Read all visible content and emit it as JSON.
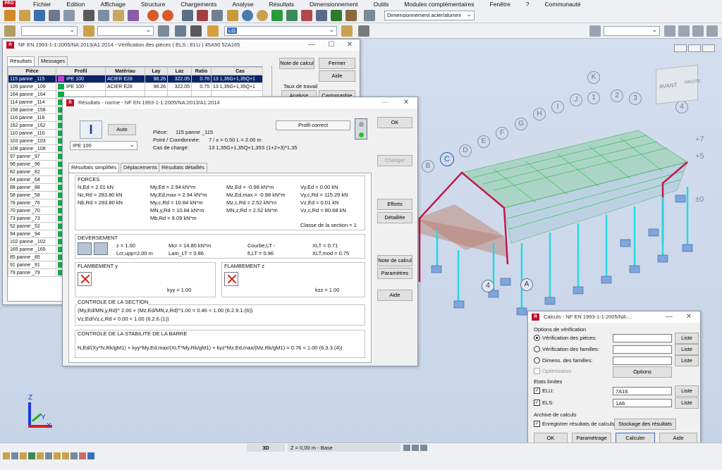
{
  "menu": [
    "Fichier",
    "Edition",
    "Affichage",
    "Structure",
    "Chargements",
    "Analyse",
    "Résultats",
    "Dimensionnement",
    "Outils",
    "Modules complémentaires",
    "Fenêtre",
    "?",
    "Communauté"
  ],
  "toolbar": {
    "dimension_combo": "Dimensionnement acier/alumini",
    "layer_value": "LG"
  },
  "results_window": {
    "title": "NF EN 1993-1-1:2005/NA:2013/A1:2014 - Vérification des pièces ( ELS ; ELU ) 45A50 52A165",
    "tabs": [
      "Résultats",
      "Messages"
    ],
    "columns": [
      "Pièce",
      "Profil",
      "Matériau",
      "Lay",
      "Laz",
      "Ratio",
      "Cas"
    ],
    "rows": [
      {
        "piece": "115  panne _115",
        "profil": "IPE 100",
        "mat": "ACIER E28",
        "lay": "98.26",
        "laz": "322.05",
        "ratio": "0.76",
        "cas": "13 1,35G+1,35Q+1"
      },
      {
        "piece": "109  panne _109",
        "profil": "IPE 100",
        "mat": "ACIER E28",
        "lay": "98.26",
        "laz": "322.05",
        "ratio": "0.75",
        "cas": "13 1,35G+1,35Q+1"
      },
      {
        "piece": "164  panne _164",
        "profil": "",
        "mat": "",
        "lay": "",
        "laz": "",
        "ratio": "",
        "cas": ""
      },
      {
        "piece": "114  panne _114",
        "profil": "",
        "mat": "",
        "lay": "",
        "laz": "",
        "ratio": "",
        "cas": ""
      },
      {
        "piece": "158  panne _158",
        "profil": "",
        "mat": "",
        "lay": "",
        "laz": "",
        "ratio": "",
        "cas": ""
      },
      {
        "piece": "116  panne _116",
        "profil": "",
        "mat": "",
        "lay": "",
        "laz": "",
        "ratio": "",
        "cas": ""
      },
      {
        "piece": "162  panne _162",
        "profil": "",
        "mat": "",
        "lay": "",
        "laz": "",
        "ratio": "",
        "cas": ""
      },
      {
        "piece": "110  panne _110",
        "profil": "",
        "mat": "",
        "lay": "",
        "laz": "",
        "ratio": "",
        "cas": ""
      },
      {
        "piece": "103  panne _103",
        "profil": "",
        "mat": "",
        "lay": "",
        "laz": "",
        "ratio": "",
        "cas": ""
      },
      {
        "piece": "108  panne _108",
        "profil": "",
        "mat": "",
        "lay": "",
        "laz": "",
        "ratio": "",
        "cas": ""
      },
      {
        "piece": "97  panne _97",
        "profil": "",
        "mat": "",
        "lay": "",
        "laz": "",
        "ratio": "",
        "cas": ""
      },
      {
        "piece": "96  panne _96",
        "profil": "",
        "mat": "",
        "lay": "",
        "laz": "",
        "ratio": "",
        "cas": ""
      },
      {
        "piece": "82  panne _82",
        "profil": "",
        "mat": "",
        "lay": "",
        "laz": "",
        "ratio": "",
        "cas": ""
      },
      {
        "piece": "64  panne _64",
        "profil": "",
        "mat": "",
        "lay": "",
        "laz": "",
        "ratio": "",
        "cas": ""
      },
      {
        "piece": "88  panne _88",
        "profil": "",
        "mat": "",
        "lay": "",
        "laz": "",
        "ratio": "",
        "cas": ""
      },
      {
        "piece": "58  panne _58",
        "profil": "",
        "mat": "",
        "lay": "",
        "laz": "",
        "ratio": "",
        "cas": ""
      },
      {
        "piece": "76  panne _76",
        "profil": "",
        "mat": "",
        "lay": "",
        "laz": "",
        "ratio": "",
        "cas": ""
      },
      {
        "piece": "70  panne _70",
        "profil": "",
        "mat": "",
        "lay": "",
        "laz": "",
        "ratio": "",
        "cas": ""
      },
      {
        "piece": "73  panne _73",
        "profil": "",
        "mat": "",
        "lay": "",
        "laz": "",
        "ratio": "",
        "cas": ""
      },
      {
        "piece": "52  panne _52",
        "profil": "",
        "mat": "",
        "lay": "",
        "laz": "",
        "ratio": "",
        "cas": ""
      },
      {
        "piece": "94  panne _94",
        "profil": "",
        "mat": "",
        "lay": "",
        "laz": "",
        "ratio": "",
        "cas": ""
      },
      {
        "piece": "102  panne _102",
        "profil": "",
        "mat": "",
        "lay": "",
        "laz": "",
        "ratio": "",
        "cas": ""
      },
      {
        "piece": "165  panne _165",
        "profil": "",
        "mat": "",
        "lay": "",
        "laz": "",
        "ratio": "",
        "cas": ""
      },
      {
        "piece": "85  panne _85",
        "profil": "",
        "mat": "",
        "lay": "",
        "laz": "",
        "ratio": "",
        "cas": ""
      },
      {
        "piece": "91  panne _91",
        "profil": "",
        "mat": "",
        "lay": "",
        "laz": "",
        "ratio": "",
        "cas": ""
      },
      {
        "piece": "79  panne _79",
        "profil": "",
        "mat": "",
        "lay": "",
        "laz": "",
        "ratio": "",
        "cas": ""
      }
    ],
    "buttons": {
      "note": "Note de calcul",
      "fermer": "Fermer",
      "aide": "Aide",
      "taux": "Taux de travail",
      "analyse": "Analyse",
      "carto": "Cartographie"
    }
  },
  "detail_window": {
    "title": "Résultats - norme - NF EN 1993-1-1:2005/NA:2013/A1:2014",
    "auto": "Auto",
    "profile": "IPE 100",
    "piece_label": "Pièce:",
    "piece_value": "115  panne _115",
    "point_label": "Point / Coordonnée:",
    "point_value": "7 / x = 0.50 L = 2.00 m",
    "cas_label": "Cas de charge:",
    "cas_value": "13 1,35G+1,35Q+1,35S  (1+2+3)*1.35",
    "status": "Profil correct",
    "tabs": [
      "Résultats simplifiés",
      "Déplacements",
      "Résultats détaillés"
    ],
    "forces_title": "FORCES",
    "forces_c1": [
      "N,Ed = 2.01 kN",
      "Nc,Rd = 283.80 kN",
      "Nb,Rd = 283.80 kN"
    ],
    "forces_c2": [
      "My,Ed = 2.94 kN*m",
      "My,Ed,max = 2.94 kN*m",
      "My,c,Rd = 10.84 kN*m",
      "MN,y,Rd = 10.84 kN*m",
      "Mb,Rd = 8.09 kN*m"
    ],
    "forces_c3": [
      "Mz,Ed = -0.98 kN*m",
      "Mz,Ed,max = -0.98 kN*m",
      "Mz,c,Rd = 2.52 kN*m",
      "MN,z,Rd = 2.52 kN*m"
    ],
    "forces_c4": [
      "Vy,Ed = 0.00 kN",
      "Vy,c,Rd = 115.29 kN",
      "Vz,Ed = 0.01 kN",
      "Vz,c,Rd = 80.68 kN"
    ],
    "classe": "Classe de la section = 1",
    "dev_title": "DEVERSEMENT",
    "dev_c1": [
      "z = 1.00",
      "Lcr,upp=2.00 m"
    ],
    "dev_c2": [
      "Mcr = 14.80 kN*m",
      "Lam_LT = 0.86"
    ],
    "dev_c3": [
      "Courbe,LT -",
      "fi,LT = 0.96"
    ],
    "dev_c4": [
      "XLT = 0.71",
      "XLT,mod = 0.75"
    ],
    "flamb_y_title": "FLAMBEMENT y",
    "kyy": "kyy = 1.00",
    "flamb_z_title": "FLAMBEMENT z",
    "kzz": "kzz = 1.00",
    "controle_section_title": "CONTROLE DE LA SECTION",
    "controle_section_1": "(My,Ed/MN,y,Rd)^ 2.00 + (Mz,Ed/MN,z,Rd)^1.00 = 0.46 < 1.00   (6.2.9.1.(6))",
    "controle_section_2": "Vz,Ed/Vz,c,Rd = 0.00 < 1.00   (6.2.6.(1))",
    "controle_barre_title": "CONTROLE DE LA STABILITE DE LA BARRE",
    "controle_barre_1": "N,Ed/(Xy*N,Rk/gM1) + kyy*My,Ed,max/(XLT*My,Rk/gM1) + kyz*Mz,Ed,max/(Mz,Rk/gM1) = 0.76 < 1.00   (6.3.3.(4))",
    "buttons": {
      "ok": "OK",
      "changer": "Changer",
      "efforts": "Efforts",
      "detaillee": "Détaillée",
      "note": "Note de calcul",
      "parametres": "Paramètres",
      "aide": "Aide"
    }
  },
  "calc_window": {
    "title": "Calculs - NF EN 1993-1-1:2005/NA:...",
    "options_title": "Options de vérification",
    "opt1": "Vérification des pièces:",
    "opt2": "Vérification des familles:",
    "opt3": "Dimens. des familles:",
    "liste": "Liste",
    "optimisation": "Optimisation",
    "options_btn": "Options",
    "etats_title": "Etats limites",
    "elu_label": "ELU:",
    "elu_value": "7A16",
    "els_label": "ELS:",
    "els_value": "1A6",
    "archive_title": "Archive de calculs",
    "enregistrer": "Enregistrer résultats de calculs",
    "stockage": "Stockage des résultats",
    "buttons": {
      "ok": "OK",
      "parametrage": "Paramétrage",
      "calculer": "Calculer",
      "aide": "Aide"
    }
  },
  "viewcube": {
    "front": "AVANT",
    "right": "DROITE"
  },
  "axes_labels": [
    "K",
    "J",
    "I",
    "H",
    "G",
    "F",
    "E",
    "D",
    "C",
    "B",
    "A",
    "1",
    "2",
    "3",
    "4",
    "+7",
    "+5",
    "±0"
  ],
  "statusbar": {
    "view": "3D",
    "level": "Z = 0,00 m - Base"
  },
  "axis_triad": {
    "x": "X",
    "y": "Y",
    "z": "Z"
  }
}
